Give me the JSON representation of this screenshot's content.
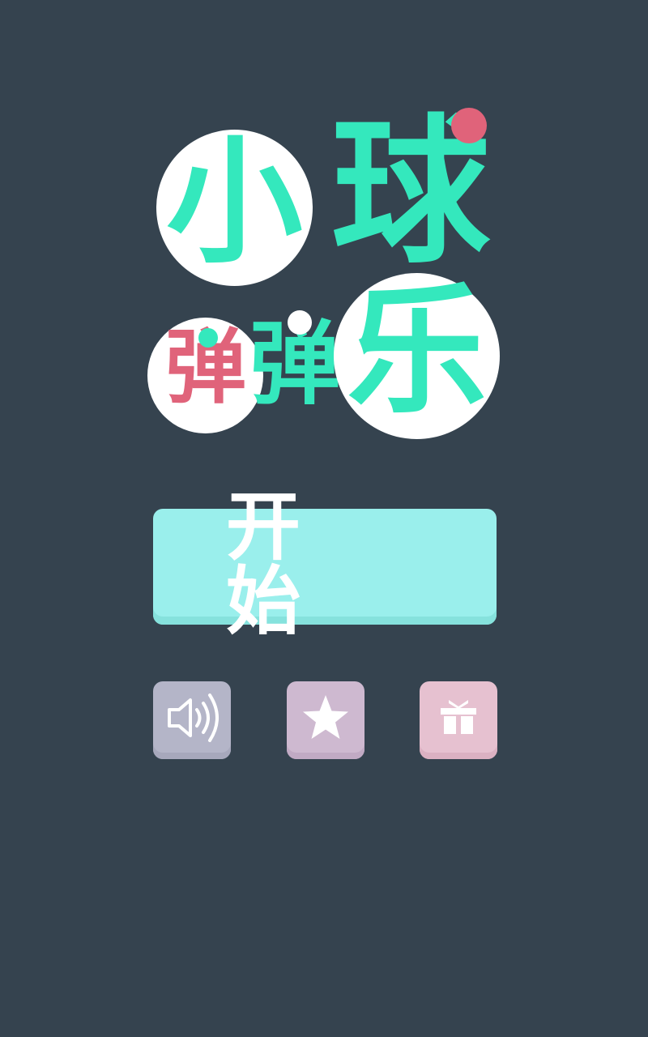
{
  "logo": {
    "char_small": "小",
    "char_ball": "球",
    "char_bounce1": "弹",
    "char_bounce2": "弹",
    "char_joy": "乐"
  },
  "start_button": {
    "label": "开始"
  },
  "buttons": {
    "sound_icon": "speaker-icon",
    "rate_icon": "star-icon",
    "gift_icon": "gift-icon"
  },
  "colors": {
    "background": "#35434f",
    "title_green": "#34e8bd",
    "title_red": "#e0637a",
    "start_button": "#9aefec",
    "sound_button": "#b4b5c8",
    "star_button": "#ceb9d0",
    "gift_button": "#e6c1d0"
  }
}
